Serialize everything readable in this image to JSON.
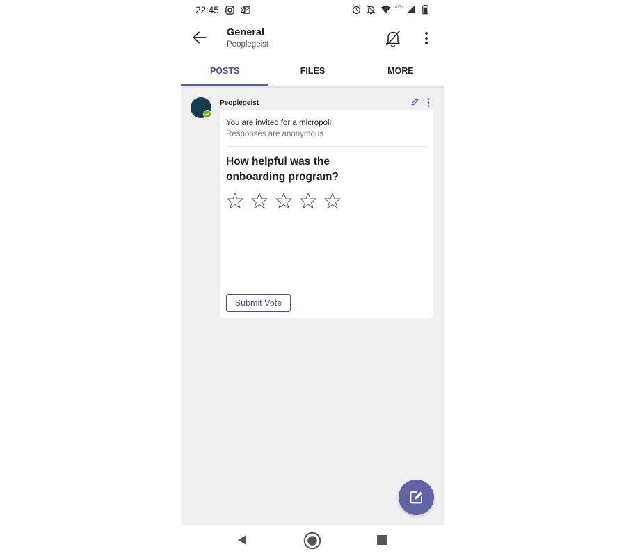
{
  "status_bar": {
    "time": "22:45",
    "network_label": "4G+",
    "left_icons": [
      "instagram-icon",
      "outlook-icon"
    ],
    "right_icons": [
      "alarm-icon",
      "notifications-off-icon",
      "wifi-icon",
      "signal-icon",
      "battery-icon"
    ]
  },
  "header": {
    "title": "General",
    "subtitle": "Peoplegeist"
  },
  "tabs": [
    {
      "label": "POSTS",
      "active": true
    },
    {
      "label": "FILES",
      "active": false
    },
    {
      "label": "MORE",
      "active": false
    }
  ],
  "post": {
    "author": "Peoplegeist",
    "invite_text": "You are invited for a micropoll",
    "anonymous_text": "Responses are anonymous",
    "question": "How helpful was the onboarding program?",
    "rating": {
      "value": 0,
      "max": 5
    },
    "submit_label": "Submit Vote"
  },
  "colors": {
    "accent": "#6264a7",
    "active_tab_text": "#4a4c9c",
    "avatar": "#183a4e",
    "presence": "#6bb700",
    "background": "#f1f0f1"
  }
}
